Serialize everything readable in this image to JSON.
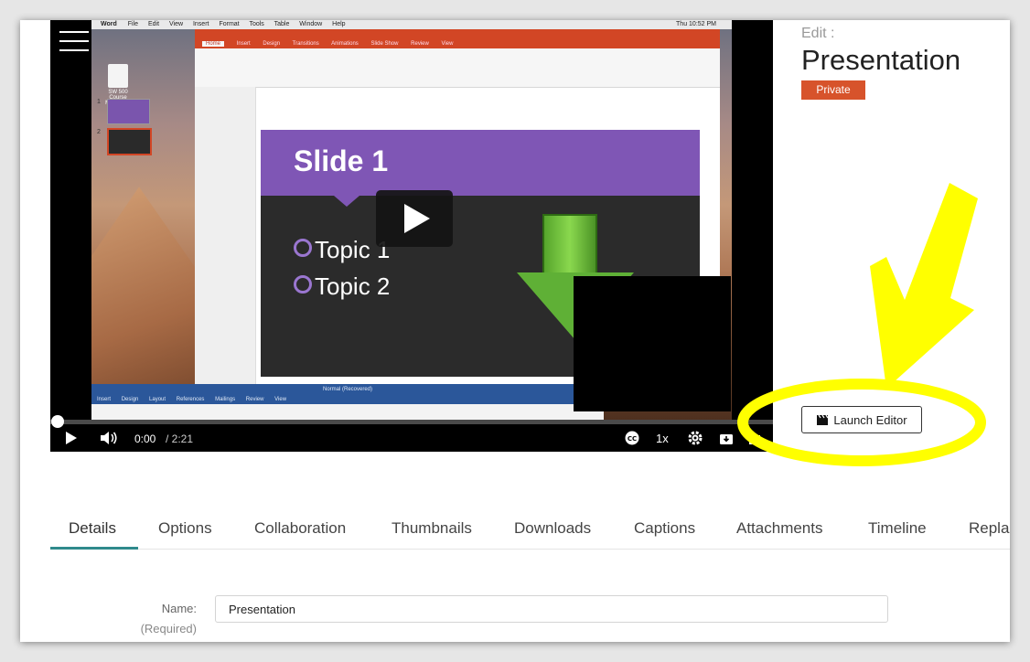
{
  "video": {
    "current_time": "0:00",
    "duration": "/ 2:21",
    "playback_rate": "1x",
    "progress": 0.0,
    "screen": {
      "mac_menu": [
        "Word",
        "File",
        "Edit",
        "View",
        "Insert",
        "Format",
        "Tools",
        "Table",
        "Window",
        "Help"
      ],
      "mac_clock": "Thu 10:52 PM",
      "ppt_tabs": [
        "Home",
        "Insert",
        "Design",
        "Transitions",
        "Animations",
        "Slide Show",
        "Review",
        "View"
      ],
      "desktop_file": "SW 500 Course Map_docx",
      "slide_title": "Slide 1",
      "topics": [
        "Topic 1",
        "Topic 2"
      ],
      "word_tabs": [
        "Insert",
        "Design",
        "Layout",
        "References",
        "Mailings",
        "Review",
        "View"
      ],
      "word_title": "Normal (Recovered)"
    }
  },
  "header": {
    "edit_label": "Edit :",
    "title": "Presentation",
    "privacy_badge": "Private"
  },
  "launch_editor_label": "Launch Editor",
  "tabs": [
    "Details",
    "Options",
    "Collaboration",
    "Thumbnails",
    "Downloads",
    "Captions",
    "Attachments",
    "Timeline",
    "Repla"
  ],
  "form": {
    "name_label": "Name:",
    "required_label": "(Required)",
    "name_value": "Presentation"
  },
  "colors": {
    "badge": "#d7532b",
    "tab_underline": "#2f8a8c",
    "annotation": "#ffff00",
    "slide_header": "#7f56b5",
    "ppt_ribbon": "#d24625"
  }
}
